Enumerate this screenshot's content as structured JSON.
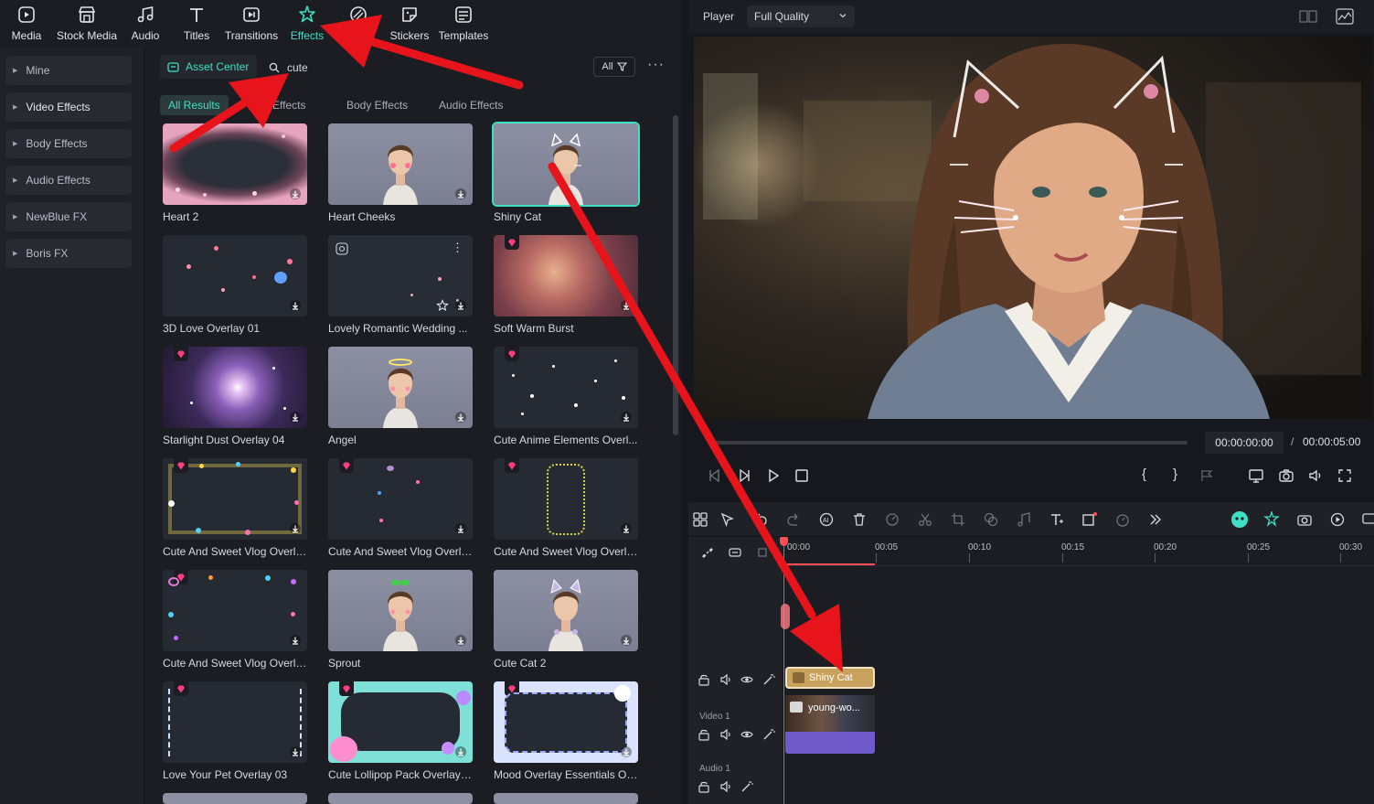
{
  "topnav": [
    {
      "label": "Media",
      "icon": "media-icon",
      "active": false
    },
    {
      "label": "Stock Media",
      "icon": "stock-media-icon",
      "active": false
    },
    {
      "label": "Audio",
      "icon": "music-note-icon",
      "active": false
    },
    {
      "label": "Titles",
      "icon": "text-t-icon",
      "active": false
    },
    {
      "label": "Transitions",
      "icon": "transitions-icon",
      "active": false
    },
    {
      "label": "Effects",
      "icon": "sparkle-icon",
      "active": true
    },
    {
      "label": "",
      "icon": "filters-icon",
      "active": false
    },
    {
      "label": "Stickers",
      "icon": "sticker-icon",
      "active": false
    },
    {
      "label": "Templates",
      "icon": "templates-icon",
      "active": false
    }
  ],
  "sidebar": {
    "items": [
      {
        "label": "Mine"
      },
      {
        "label": "Video Effects"
      },
      {
        "label": "Body Effects"
      },
      {
        "label": "Audio Effects"
      },
      {
        "label": "NewBlue FX"
      },
      {
        "label": "Boris FX"
      }
    ]
  },
  "browser": {
    "asset_center": "Asset Center",
    "search_value": "cute",
    "filter_label": "All",
    "subtabs": [
      "All Results",
      "o Effects",
      "Body Effects",
      "Audio Effects"
    ],
    "items": [
      {
        "label": "Heart 2",
        "premium": false,
        "thumb": "pink-border"
      },
      {
        "label": "Heart Cheeks",
        "premium": false,
        "thumb": "portrait-hearts"
      },
      {
        "label": "Shiny Cat",
        "premium": false,
        "thumb": "portrait-cat",
        "selected": true
      },
      {
        "label": "3D Love Overlay 01",
        "premium": false,
        "thumb": "dark-hearts"
      },
      {
        "label": "Lovely Romantic Wedding ...",
        "premium": false,
        "thumb": "dark-dots"
      },
      {
        "label": "Soft Warm Burst",
        "premium": true,
        "thumb": "warm-bokeh"
      },
      {
        "label": "Starlight Dust Overlay 04",
        "premium": true,
        "thumb": "starlight"
      },
      {
        "label": "Angel",
        "premium": false,
        "thumb": "portrait-halo"
      },
      {
        "label": "Cute Anime Elements Overl...",
        "premium": true,
        "thumb": "white-specks"
      },
      {
        "label": "Cute And Sweet Vlog Overla...",
        "premium": true,
        "thumb": "frame-colorful"
      },
      {
        "label": "Cute And Sweet Vlog Overla...",
        "premium": true,
        "thumb": "frame-sparse"
      },
      {
        "label": "Cute And Sweet Vlog Overla...",
        "premium": true,
        "thumb": "frame-yellow"
      },
      {
        "label": "Cute And Sweet Vlog Overla...",
        "premium": true,
        "thumb": "frame-doodle"
      },
      {
        "label": "Sprout",
        "premium": false,
        "thumb": "portrait-sprout"
      },
      {
        "label": "Cute Cat 2",
        "premium": false,
        "thumb": "portrait-cat2"
      },
      {
        "label": "Love Your Pet Overlay 03",
        "premium": true,
        "thumb": "frame-dashes"
      },
      {
        "label": "Cute Lollipop Pack Overlay 01",
        "premium": true,
        "thumb": "lollipop"
      },
      {
        "label": "Mood Overlay Essentials Ov...",
        "premium": true,
        "thumb": "mood-frame"
      }
    ]
  },
  "player": {
    "label": "Player",
    "quality": "Full Quality",
    "current_time": "00:00:00:00",
    "separator": "/",
    "total_time": "00:00:05:00"
  },
  "timeline": {
    "ruler": [
      "00:00",
      "00:05",
      "00:10",
      "00:15",
      "00:20",
      "00:25",
      "00:30"
    ],
    "tracks": {
      "video": "Video 1",
      "audio": "Audio 1"
    },
    "clips": {
      "effect": "Shiny Cat",
      "video": "young-wo..."
    }
  },
  "colors": {
    "accent": "#3ee0c3",
    "annotation_arrow": "#e8141c",
    "effect_clip": "#c9a25e",
    "video_clip": "#6e5ac9",
    "playhead": "#ff4d55",
    "premium_gem": "#ff3d7f"
  }
}
